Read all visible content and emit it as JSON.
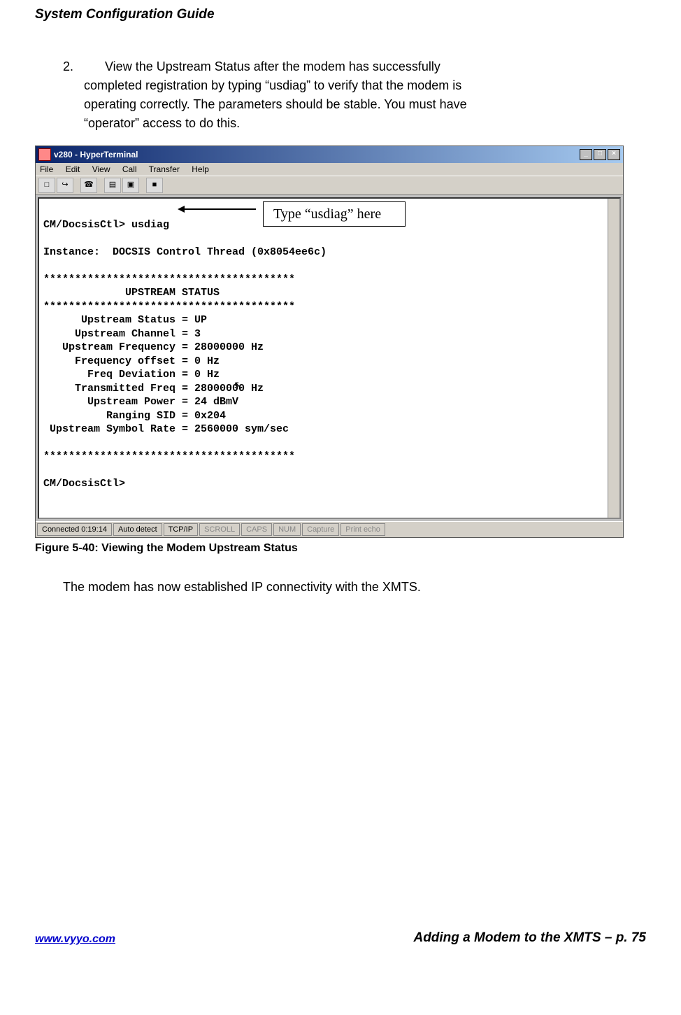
{
  "header": {
    "title": "System Configuration Guide"
  },
  "step": {
    "number": "2.",
    "text_line1": "View the Upstream Status after the modem has successfully",
    "text_line2": "completed registration by typing “usdiag” to verify that the modem is",
    "text_line3": "operating correctly.    The parameters should be stable.  You must have",
    "text_line4": "“operator” access to do this."
  },
  "window": {
    "title": "v280 - HyperTerminal",
    "btn_min": "_",
    "btn_max": "□",
    "btn_close": "×",
    "menu": {
      "file": "File",
      "edit": "Edit",
      "view": "View",
      "call": "Call",
      "transfer": "Transfer",
      "help": "Help"
    },
    "toolbar_icons": [
      "□",
      "↪",
      "☎",
      "",
      "▤",
      "▣",
      "",
      "■"
    ]
  },
  "callout": {
    "label": "Type “usdiag” here"
  },
  "terminal": {
    "line_prompt_cmd": "CM/DocsisCtl> usdiag",
    "blank": "",
    "instance": "Instance:  DOCSIS Control Thread (0x8054ee6c)",
    "stars": "****************************************",
    "heading": "             UPSTREAM STATUS",
    "l_status": "      Upstream Status = UP",
    "l_channel": "     Upstream Channel = 3",
    "l_freq": "   Upstream Frequency = 28000000 Hz",
    "l_offset": "     Frequency offset = 0 Hz",
    "l_dev": "       Freq Deviation = 0 Hz",
    "l_txfreq": "     Transmitted Freq = 28000000 Hz",
    "l_power": "       Upstream Power = 24 dBmV",
    "l_sid": "          Ranging SID = 0x204",
    "l_symrate": " Upstream Symbol Rate = 2560000 sym/sec",
    "prompt2": "CM/DocsisCtl>"
  },
  "statusbar": {
    "connected": "Connected 0:19:14",
    "detect": "Auto detect",
    "proto": "TCP/IP",
    "scroll": "SCROLL",
    "caps": "CAPS",
    "num": "NUM",
    "capture": "Capture",
    "echo": "Print echo"
  },
  "figure_caption": "Figure 5-40: Viewing the Modem Upstream Status",
  "after_text": "The modem has now established IP connectivity with the XMTS.",
  "footer": {
    "site": "www.vyyo.com",
    "page": "Adding a Modem to the XMTS – p. 75"
  }
}
